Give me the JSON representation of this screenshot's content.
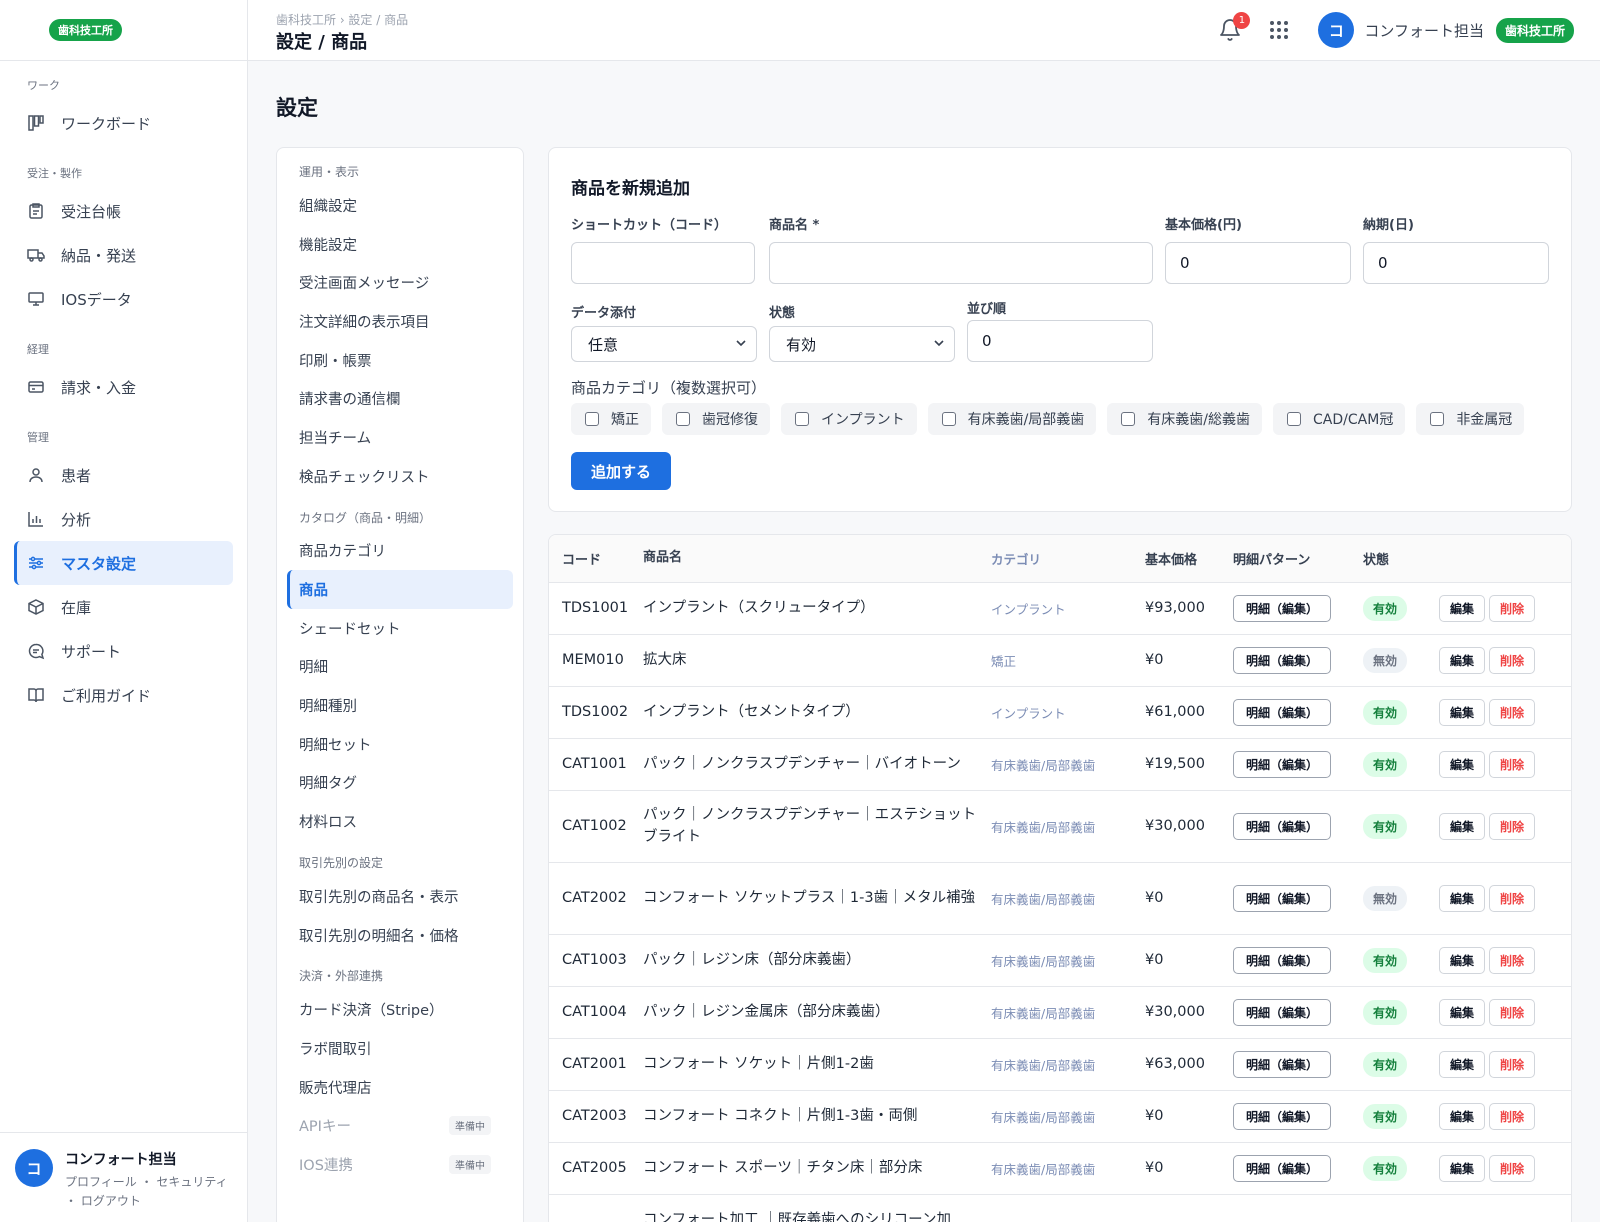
{
  "org_badge": "歯科技工所",
  "sidebar": {
    "sections": [
      {
        "label": "ワーク",
        "items": [
          {
            "label": "ワークボード",
            "icon": "kanban-icon"
          }
        ]
      },
      {
        "label": "受注・製作",
        "items": [
          {
            "label": "受注台帳",
            "icon": "clipboard-icon"
          },
          {
            "label": "納品・発送",
            "icon": "truck-icon"
          },
          {
            "label": "IOSデータ",
            "icon": "monitor-icon"
          }
        ]
      },
      {
        "label": "経理",
        "items": [
          {
            "label": "請求・入金",
            "icon": "credit-card-icon"
          }
        ]
      },
      {
        "label": "管理",
        "items": [
          {
            "label": "患者",
            "icon": "user-icon"
          },
          {
            "label": "分析",
            "icon": "bar-chart-icon"
          },
          {
            "label": "マスタ設定",
            "icon": "sliders-icon",
            "active": true
          },
          {
            "label": "在庫",
            "icon": "box-icon"
          },
          {
            "label": "サポート",
            "icon": "chat-icon"
          },
          {
            "label": "ご利用ガイド",
            "icon": "book-icon"
          }
        ]
      }
    ],
    "user": {
      "initial": "コ",
      "name": "コンフォート担当",
      "links": "プロフィール ・ セキュリティ ・ ログアウト"
    }
  },
  "topbar": {
    "breadcrumb": "歯科技工所 › 設定 / 商品",
    "title": "設定 / 商品",
    "notification_count": "1",
    "user_initial": "コ",
    "user_name": "コンフォート担当",
    "org_badge": "歯科技工所"
  },
  "settings_title": "設定",
  "settings_menu": [
    {
      "section": "運用・表示",
      "items": [
        {
          "label": "組織設定"
        },
        {
          "label": "機能設定"
        },
        {
          "label": "受注画面メッセージ"
        },
        {
          "label": "注文詳細の表示項目"
        },
        {
          "label": "印刷・帳票"
        },
        {
          "label": "請求書の通信欄"
        },
        {
          "label": "担当チーム"
        },
        {
          "label": "検品チェックリスト"
        }
      ]
    },
    {
      "section": "カタログ（商品・明細）",
      "items": [
        {
          "label": "商品カテゴリ"
        },
        {
          "label": "商品",
          "active": true
        },
        {
          "label": "シェードセット"
        },
        {
          "label": "明細"
        },
        {
          "label": "明細種別"
        },
        {
          "label": "明細セット"
        },
        {
          "label": "明細タグ"
        },
        {
          "label": "材料ロス"
        }
      ]
    },
    {
      "section": "取引先別の設定",
      "items": [
        {
          "label": "取引先別の商品名・表示"
        },
        {
          "label": "取引先別の明細名・価格"
        }
      ]
    },
    {
      "section": "決済・外部連携",
      "items": [
        {
          "label": "カード決済（Stripe）"
        },
        {
          "label": "ラボ間取引"
        },
        {
          "label": "販売代理店"
        },
        {
          "label": "APIキー",
          "tag": "準備中",
          "muted": true
        },
        {
          "label": "IOS連携",
          "tag": "準備中",
          "muted": true
        }
      ]
    }
  ],
  "add_form": {
    "title": "商品を新規追加",
    "shortcut_label": "ショートカット（コード）",
    "shortcut_value": "",
    "name_label": "商品名 *",
    "name_value": "",
    "price_label": "基本価格(円)",
    "price_value": "0",
    "delivery_label": "納期(日)",
    "delivery_value": "0",
    "data_label": "データ添付",
    "data_value": "任意",
    "state_label": "状態",
    "state_value": "有効",
    "order_label": "並び順",
    "order_value": "0",
    "category_label": "商品カテゴリ（複数選択可）",
    "categories": [
      "矯正",
      "歯冠修復",
      "インプラント",
      "有床義歯/局部義歯",
      "有床義歯/総義歯",
      "CAD/CAM冠",
      "非金属冠"
    ],
    "submit_label": "追加する"
  },
  "table": {
    "headers": {
      "code": "コード",
      "name": "商品名",
      "category": "カテゴリ",
      "price": "基本価格",
      "pattern": "明細パターン",
      "state": "状態"
    },
    "pattern_label": "明細（編集）",
    "edit_label": "編集",
    "delete_label": "削除",
    "rows": [
      {
        "code": "TDS1001",
        "name": "インプラント（スクリュータイプ）",
        "category": "インプラント",
        "price": "¥93,000",
        "state": "有効",
        "active": true
      },
      {
        "code": "MEM010",
        "name": "拡大床",
        "category": "矯正",
        "price": "¥0",
        "state": "無効",
        "active": false
      },
      {
        "code": "TDS1002",
        "name": "インプラント（セメントタイプ）",
        "category": "インプラント",
        "price": "¥61,000",
        "state": "有効",
        "active": true
      },
      {
        "code": "CAT1001",
        "name": "パック｜ノンクラスプデンチャー｜バイオトーン",
        "category": "有床義歯/局部義歯",
        "price": "¥19,500",
        "state": "有効",
        "active": true
      },
      {
        "code": "CAT1002",
        "name": "パック｜ノンクラスプデンチャー｜エステショットブライト",
        "category": "有床義歯/局部義歯",
        "price": "¥30,000",
        "state": "有効",
        "active": true,
        "tall": true
      },
      {
        "code": "CAT2002",
        "name": "コンフォート ソケットプラス｜1-3歯｜メタル補強",
        "category": "有床義歯/局部義歯",
        "price": "¥0",
        "state": "無効",
        "active": false,
        "tall": true
      },
      {
        "code": "CAT1003",
        "name": "パック｜レジン床（部分床義歯）",
        "category": "有床義歯/局部義歯",
        "price": "¥0",
        "state": "有効",
        "active": true
      },
      {
        "code": "CAT1004",
        "name": "パック｜レジン金属床（部分床義歯）",
        "category": "有床義歯/局部義歯",
        "price": "¥30,000",
        "state": "有効",
        "active": true
      },
      {
        "code": "CAT2001",
        "name": "コンフォート ソケット｜片側1-2歯",
        "category": "有床義歯/局部義歯",
        "price": "¥63,000",
        "state": "有効",
        "active": true
      },
      {
        "code": "CAT2003",
        "name": "コンフォート コネクト｜片側1-3歯・両側",
        "category": "有床義歯/局部義歯",
        "price": "¥0",
        "state": "有効",
        "active": true
      },
      {
        "code": "CAT2005",
        "name": "コンフォート スポーツ｜チタン床｜部分床",
        "category": "有床義歯/局部義歯",
        "price": "¥0",
        "state": "有効",
        "active": true
      },
      {
        "code": "",
        "name": "コンフォート加工 ｜既存義歯へのシリコーン加",
        "category": "",
        "price": "",
        "state": "",
        "active": true
      }
    ]
  }
}
